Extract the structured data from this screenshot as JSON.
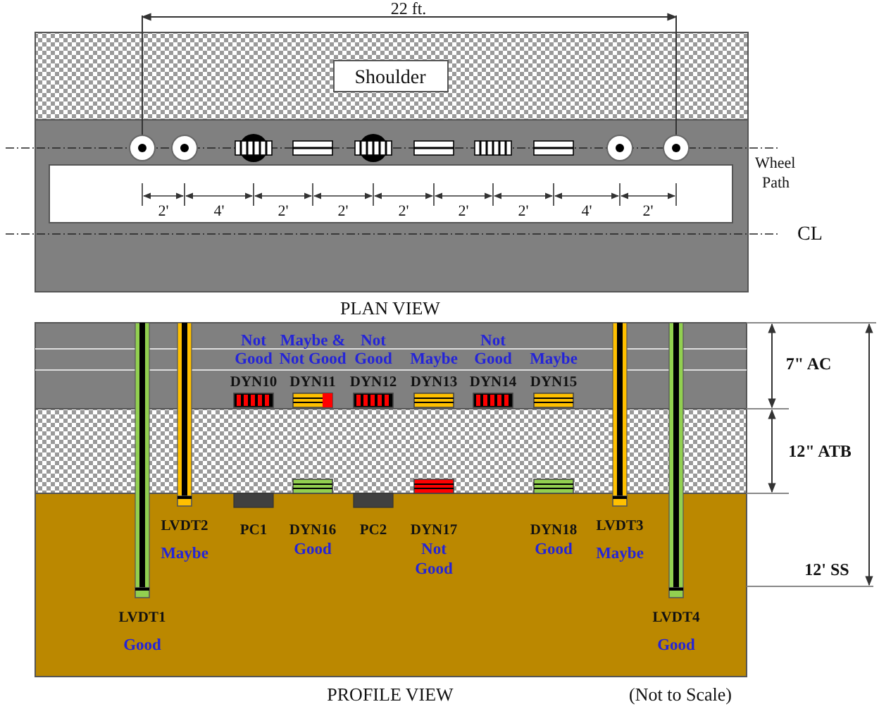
{
  "plan_view": {
    "dimension": "22 ft.",
    "shoulder": "Shoulder",
    "wheel_path": [
      "Wheel",
      "Path"
    ],
    "centerline": "CL",
    "spacings": [
      "2'",
      "4'",
      "2'",
      "2'",
      "2'",
      "2'",
      "2'",
      "4'",
      "2'"
    ],
    "sensors": [
      {
        "kind": "lvdt"
      },
      {
        "kind": "lvdt"
      },
      {
        "kind": "pc"
      },
      {
        "kind": "long"
      },
      {
        "kind": "pc"
      },
      {
        "kind": "long"
      },
      {
        "kind": "trans"
      },
      {
        "kind": "long"
      },
      {
        "kind": "lvdt"
      },
      {
        "kind": "lvdt"
      }
    ],
    "title": "PLAN VIEW"
  },
  "profile_view": {
    "layers": [
      {
        "kind": "ac",
        "label": "7\" AC"
      },
      {
        "kind": "atb",
        "label": "12\" ATB"
      },
      {
        "kind": "ss",
        "label": "12' SS"
      }
    ],
    "top_gauges": [
      {
        "name": "DYN10",
        "status": [
          "Not",
          "Good"
        ],
        "kind": "trans",
        "color": "#ff0000"
      },
      {
        "name": "DYN11",
        "status": [
          "Maybe &",
          "Not Good"
        ],
        "kind": "long",
        "color": "#ffc000",
        "end_segment": {
          "color": "#ff0000"
        }
      },
      {
        "name": "DYN12",
        "status": [
          "Not",
          "Good"
        ],
        "kind": "trans",
        "color": "#ff0000"
      },
      {
        "name": "DYN13",
        "status": [
          "Maybe"
        ],
        "kind": "long",
        "color": "#ffc000"
      },
      {
        "name": "DYN14",
        "status": [
          "Not",
          "Good"
        ],
        "kind": "trans",
        "color": "#ff0000"
      },
      {
        "name": "DYN15",
        "status": [
          "Maybe"
        ],
        "kind": "long",
        "color": "#ffc000"
      }
    ],
    "bottom_gauges": [
      {
        "name": "PC1",
        "kind": "pc"
      },
      {
        "name": "DYN16",
        "status": [
          "Good"
        ],
        "kind": "long",
        "color": "#92d050"
      },
      {
        "name": "PC2",
        "kind": "pc"
      },
      {
        "name": "DYN17",
        "status": [
          "Not",
          "Good"
        ],
        "kind": "long",
        "color": "#ff0000"
      },
      {
        "name": "DYN18",
        "status": [
          "Good"
        ],
        "kind": "long",
        "color": "#92d050"
      }
    ],
    "lvdts": [
      {
        "name": "LVDT1",
        "status": "Good",
        "color": "#92d050"
      },
      {
        "name": "LVDT2",
        "status": "Maybe",
        "color": "#ffc000"
      },
      {
        "name": "LVDT3",
        "status": "Maybe",
        "color": "#ffc000"
      },
      {
        "name": "LVDT4",
        "status": "Good",
        "color": "#92d050"
      }
    ],
    "title": "PROFILE VIEW",
    "note": "(Not to Scale)"
  }
}
